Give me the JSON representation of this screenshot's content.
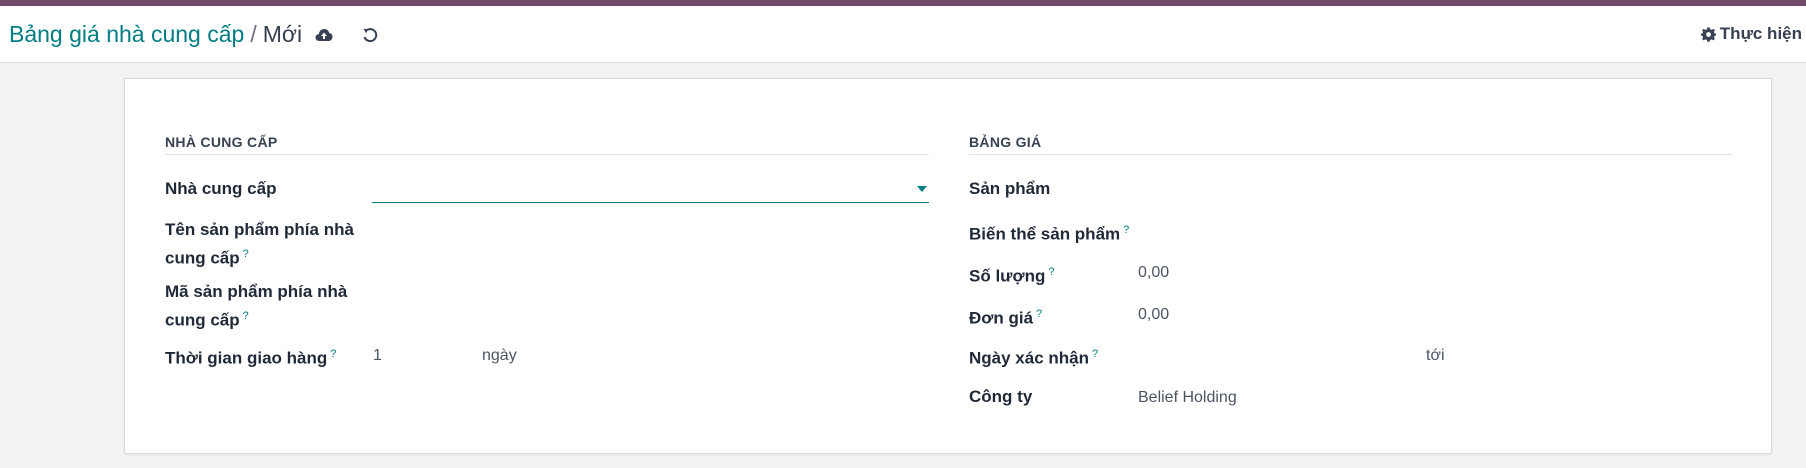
{
  "breadcrumb": {
    "parent": "Bảng giá nhà cung cấp",
    "separator": "/",
    "current": "Mới"
  },
  "toolbar": {
    "save_icon": "cloud-upload-icon",
    "discard_icon": "undo-icon",
    "actions_label": "Thực hiện",
    "actions_icon": "gear-icon"
  },
  "colors": {
    "brand": "#714b67",
    "accent": "#017e84"
  },
  "form": {
    "vendor_group": {
      "title": "NHÀ CUNG CẤP",
      "vendor_label": "Nhà cung cấp",
      "vendor_value": "",
      "product_name_label_1": "Tên sản phẩm phía nhà",
      "product_name_label_2": "cung cấp",
      "product_code_label_1": "Mã sản phẩm phía nhà",
      "product_code_label_2": "cung cấp",
      "lead_time_label": "Thời gian giao hàng",
      "lead_time_value": "1",
      "lead_time_unit": "ngày",
      "help_mark": "?"
    },
    "price_group": {
      "title": "BẢNG GIÁ",
      "product_label": "Sản phẩm",
      "variant_label": "Biến thể sản phẩm",
      "quantity_label": "Số lượng",
      "quantity_value": "0,00",
      "unit_price_label": "Đơn giá",
      "unit_price_value": "0,00",
      "date_label": "Ngày xác nhận",
      "date_to_label": "tới",
      "company_label": "Công ty",
      "company_value": "Belief Holding",
      "help_mark": "?"
    }
  }
}
